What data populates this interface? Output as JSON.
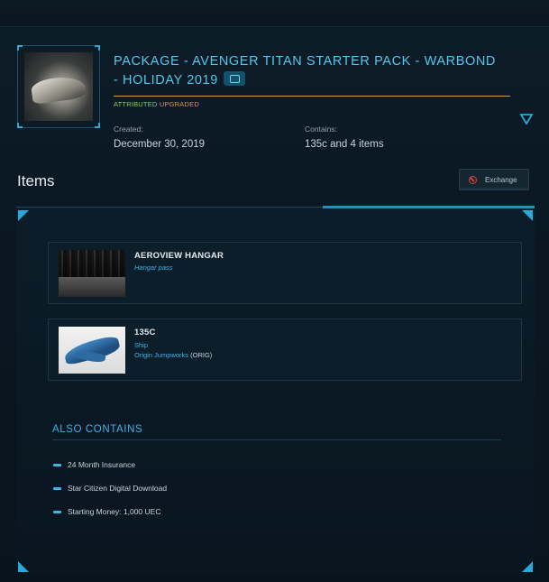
{
  "package": {
    "title": "PACKAGE - AVENGER TITAN STARTER PACK - WARBOND - HOLIDAY 2019",
    "flag_attributed": "ATTRIBUTED",
    "flag_upgraded": "UPGRADED",
    "created_label": "Created:",
    "created_value": "December 30, 2019",
    "contains_label": "Contains:",
    "contains_value": "135c and 4 items",
    "thumbnail_icon": "ship-thumbnail",
    "badge_icon": "gift-icon",
    "toggle_icon": "chevron-down-icon"
  },
  "items_section": {
    "heading": "Items",
    "exchange_label": "Exchange",
    "exchange_icon": "no-entry-icon"
  },
  "items": [
    {
      "name": "AEROVIEW HANGAR",
      "type": "Hangar pass"
    },
    {
      "name": "135C",
      "type": "Ship",
      "manufacturer": "Origin Jumpworks",
      "manufacturer_code": "(ORIG)"
    }
  ],
  "also_contains": {
    "heading": "ALSO CONTAINS",
    "entries": [
      "24 Month Insurance",
      "Star Citizen Digital Download",
      "Starting Money: 1,000 UEC"
    ]
  },
  "colors": {
    "accent": "#52c8ee",
    "link": "#3fb2e6",
    "attributed": "#7fd64a",
    "upgraded": "#e09a2a",
    "gold_rule": "#c9a64a",
    "exchange_icon": "#e0413a"
  }
}
